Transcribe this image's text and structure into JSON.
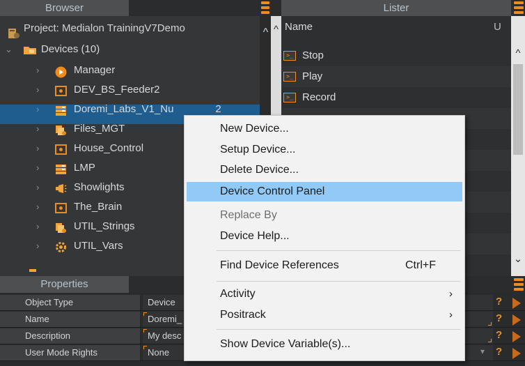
{
  "browser": {
    "tab_label": "Browser",
    "project_label": "Project: Medialon TrainingV7Demo",
    "devices_label": "Devices (10)",
    "devices": [
      {
        "label": "Manager",
        "icon": "manager-play-icon"
      },
      {
        "label": "DEV_BS_Feeder2",
        "icon": "device-box-icon"
      },
      {
        "label": "Doremi_Labs_V1_Nu",
        "icon": "device-stack-icon"
      },
      {
        "label": "Files_MGT",
        "icon": "files-icon"
      },
      {
        "label": "House_Control",
        "icon": "device-box-icon"
      },
      {
        "label": "LMP",
        "icon": "device-stack-icon"
      },
      {
        "label": "Showlights",
        "icon": "light-icon"
      },
      {
        "label": "The_Brain",
        "icon": "device-box-icon"
      },
      {
        "label": "UTIL_Strings",
        "icon": "strings-icon"
      },
      {
        "label": "UTIL_Vars",
        "icon": "vars-gear-icon"
      }
    ],
    "selected_suffix": "2"
  },
  "lister": {
    "tab_label": "Lister",
    "header_name": "Name",
    "header_u": "U",
    "items": [
      "Stop",
      "Play",
      "Record"
    ]
  },
  "properties": {
    "tab_label": "Properties",
    "rows": [
      {
        "name": "Object Type",
        "value": "Device"
      },
      {
        "name": "Name",
        "value": "Doremi_"
      },
      {
        "name": "Description",
        "value": "My desc"
      },
      {
        "name": "User Mode Rights",
        "value": "None"
      }
    ]
  },
  "context_menu": {
    "items": [
      {
        "label": "New Device...",
        "state": "normal"
      },
      {
        "label": "Setup Device...",
        "state": "normal"
      },
      {
        "label": "Delete Device...",
        "state": "normal"
      },
      {
        "label": "Device Control Panel",
        "state": "highlighted"
      },
      {
        "label": "Replace By",
        "state": "disabled"
      },
      {
        "label": "Device Help...",
        "state": "normal"
      },
      {
        "label": "Find Device References",
        "shortcut": "Ctrl+F",
        "state": "normal"
      },
      {
        "label": "Activity",
        "submenu": true,
        "state": "normal"
      },
      {
        "label": "Positrack",
        "submenu": true,
        "state": "normal"
      },
      {
        "label": "Show Device Variable(s)...",
        "state": "normal"
      }
    ]
  },
  "colors": {
    "accent": "#f08b1d",
    "selection": "#1f5d8f",
    "menu_highlight": "#91c9f7"
  }
}
